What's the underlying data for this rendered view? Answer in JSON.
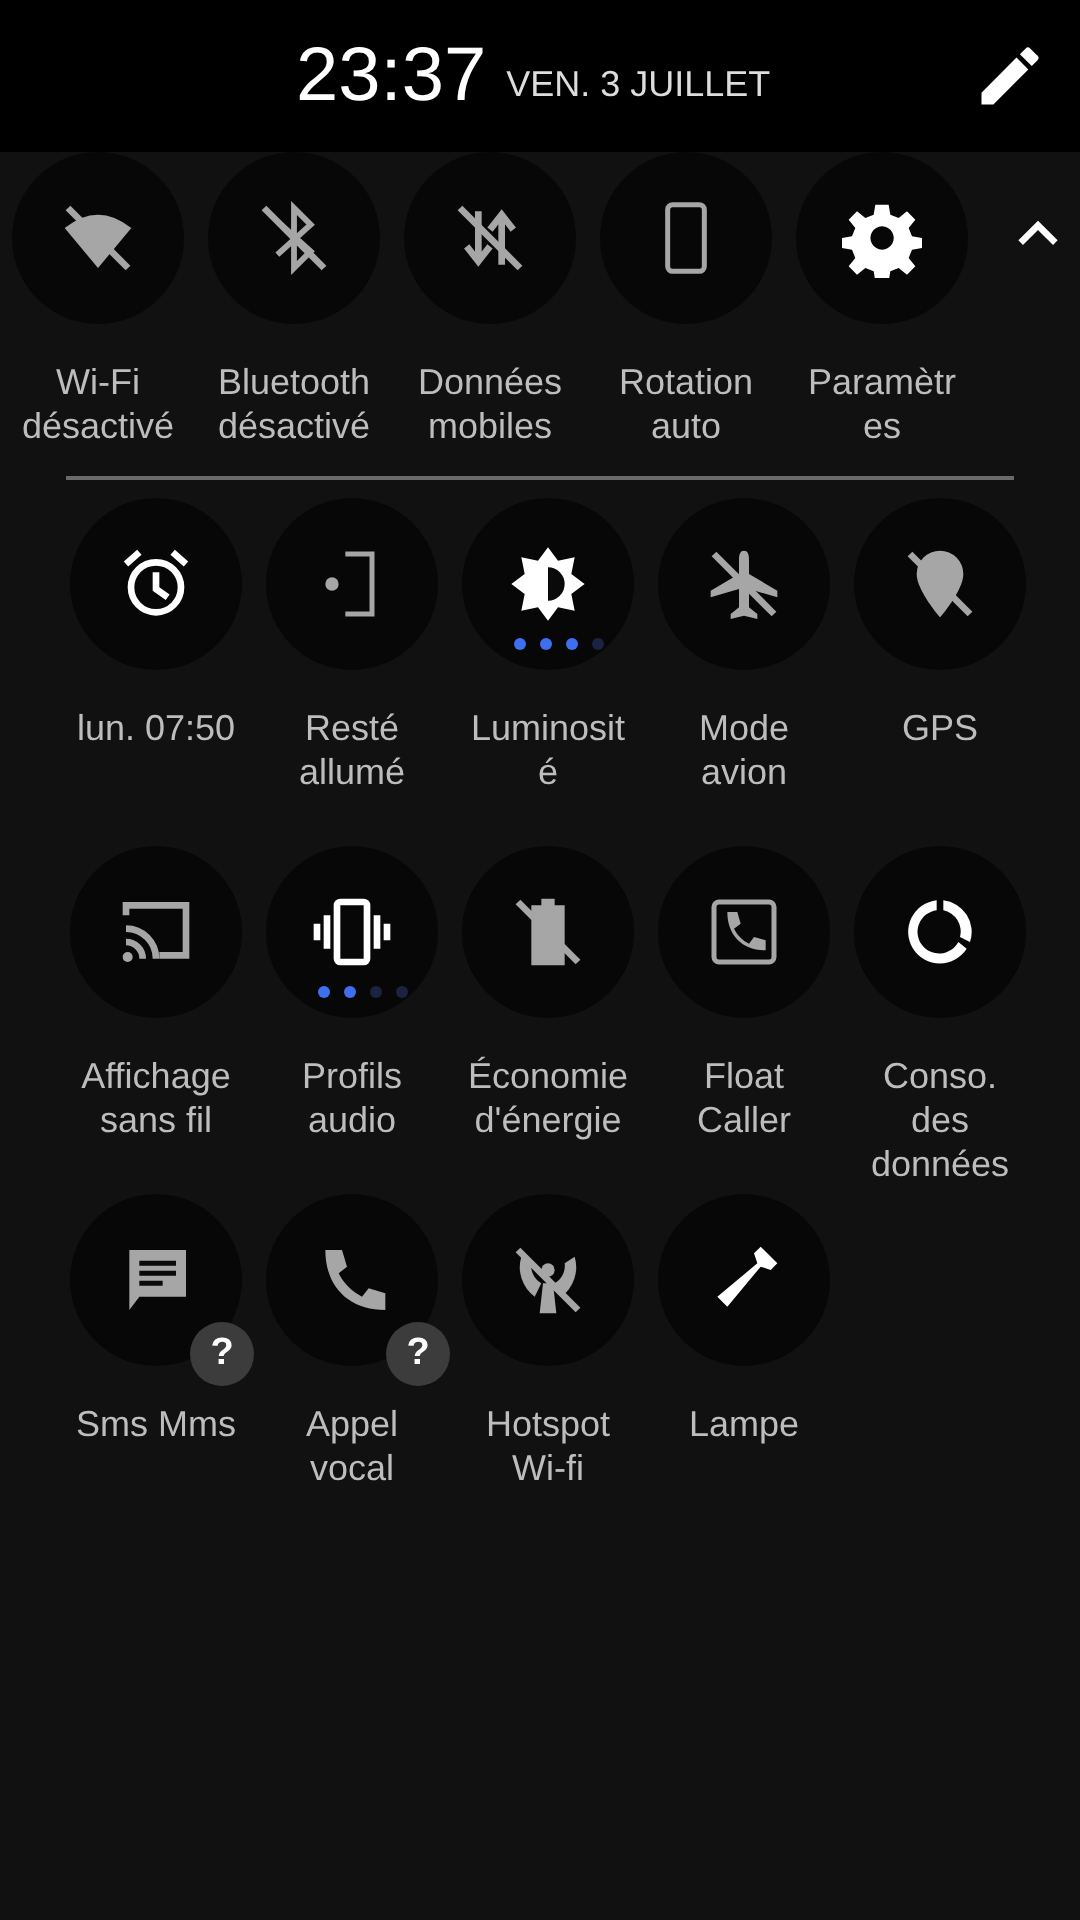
{
  "header": {
    "time": "23:37",
    "date": "VEN. 3 JUILLET"
  },
  "top_tiles": [
    {
      "label": "Wi-Fi désactivé",
      "on": false
    },
    {
      "label": "Bluetooth désactivé",
      "on": false
    },
    {
      "label": "Données mobiles",
      "on": false
    },
    {
      "label": "Rotation auto",
      "on": false
    },
    {
      "label": "Paramètres",
      "on": true
    }
  ],
  "tiles": [
    {
      "label": "lun. 07:50",
      "on": true
    },
    {
      "label": "Resté allumé",
      "on": false
    },
    {
      "label": "Luminosité",
      "on": true,
      "level": 0.75
    },
    {
      "label": "Mode avion",
      "on": false
    },
    {
      "label": "GPS",
      "on": false
    },
    {
      "label": "Affichage sans fil",
      "on": false
    },
    {
      "label": "Profils audio",
      "on": true,
      "level": 0.5
    },
    {
      "label": "Économie d'énergie",
      "on": false
    },
    {
      "label": "Float Caller",
      "on": false
    },
    {
      "label": "Conso. des données",
      "on": true
    },
    {
      "label": "Sms Mms",
      "on": false,
      "badge": "?"
    },
    {
      "label": "Appel vocal",
      "on": false,
      "badge": "?"
    },
    {
      "label": "Hotspot Wi-fi",
      "on": false
    },
    {
      "label": "Lampe",
      "on": true
    }
  ]
}
